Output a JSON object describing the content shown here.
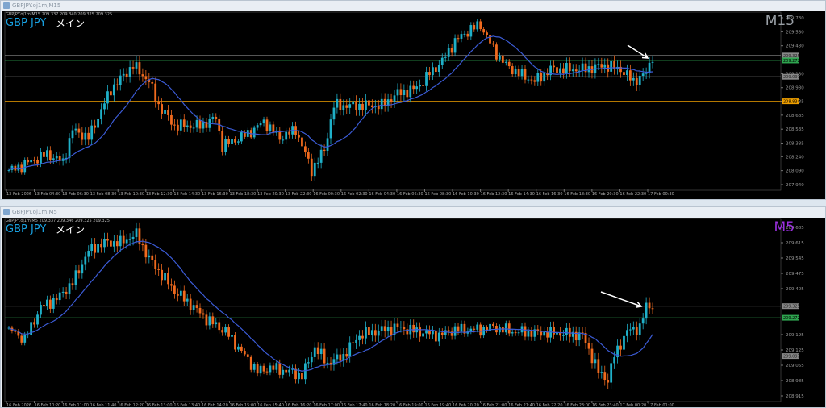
{
  "windows": [
    {
      "title": "GBPJPY.oj1m,M15",
      "header": "GBPJPY.oj1m,M15  209.337 209.340 209.325 209.325",
      "symbol": "GBP JPY",
      "mode": "メイン",
      "timeframe": "M15",
      "timeframe_color": "#9aa0a6"
    },
    {
      "title": "GBPJPY.oj1m,M5",
      "header": "GBPJPY.oj1m,M5  209.337 209.346 209.325 209.325",
      "symbol": "GBP JPY",
      "mode": "メイン",
      "timeframe": "M5",
      "timeframe_color": "#9b30e0"
    }
  ],
  "colors": {
    "bull": "#1fb0c8",
    "bear": "#f06a1e",
    "ma": "#3b5bd6",
    "green_line": "#2ea44f",
    "orange_line": "#f0a000",
    "gray_line": "#888888"
  },
  "chart_data": [
    {
      "type": "candlestick",
      "title": "GBPJPY M15",
      "ylim": [
        207.94,
        209.73
      ],
      "yticks": [
        "209.730",
        "209.580",
        "209.430",
        "209.130",
        "208.980",
        "208.835",
        "208.685",
        "208.535",
        "208.385",
        "208.240",
        "208.090",
        "207.940"
      ],
      "xticks": [
        "13 Feb 2026",
        "13 Feb 04:30",
        "13 Feb 06:30",
        "13 Feb 08:30",
        "13 Feb 10:30",
        "13 Feb 12:30",
        "13 Feb 14:30",
        "13 Feb 16:30",
        "13 Feb 18:30",
        "13 Feb 20:30",
        "13 Feb 22:30",
        "16 Feb 00:30",
        "16 Feb 02:30",
        "16 Feb 04:30",
        "16 Feb 06:30",
        "16 Feb 08:30",
        "16 Feb 10:30",
        "16 Feb 12:30",
        "16 Feb 14:30",
        "16 Feb 16:30",
        "16 Feb 18:30",
        "16 Feb 20:30",
        "16 Feb 22:30",
        "17 Feb 00:30"
      ],
      "bars": 203,
      "close_path": [
        [
          1,
          208.096
        ],
        [
          12,
          208.269
        ],
        [
          17,
          208.182
        ],
        [
          20,
          208.528
        ],
        [
          25,
          208.442
        ],
        [
          32,
          208.961
        ],
        [
          39,
          209.22
        ],
        [
          44,
          209.047
        ],
        [
          47,
          208.788
        ],
        [
          52,
          208.571
        ],
        [
          60,
          208.571
        ],
        [
          65,
          208.658
        ],
        [
          67,
          208.355
        ],
        [
          75,
          208.485
        ],
        [
          80,
          208.615
        ],
        [
          85,
          208.442
        ],
        [
          90,
          208.528
        ],
        [
          95,
          208.096
        ],
        [
          99,
          208.312
        ],
        [
          102,
          208.788
        ],
        [
          110,
          208.788
        ],
        [
          117,
          208.788
        ],
        [
          122,
          208.918
        ],
        [
          127,
          208.961
        ],
        [
          130,
          209.047
        ],
        [
          132,
          209.134
        ],
        [
          136,
          209.264
        ],
        [
          140,
          209.48
        ],
        [
          145,
          209.61
        ],
        [
          148,
          209.653
        ],
        [
          152,
          209.393
        ],
        [
          156,
          209.22
        ],
        [
          160,
          209.134
        ],
        [
          165,
          209.047
        ],
        [
          170,
          209.177
        ],
        [
          180,
          209.177
        ],
        [
          187,
          209.22
        ],
        [
          192,
          209.177
        ],
        [
          196,
          209.047
        ],
        [
          200,
          209.134
        ],
        [
          202,
          209.324
        ]
      ],
      "levels": [
        {
          "label": "209.325",
          "price": 209.325,
          "kind": "gray"
        },
        {
          "label": "209.272",
          "price": 209.272,
          "kind": "green"
        },
        {
          "label": "209.097",
          "price": 209.097,
          "kind": "gray"
        },
        {
          "label": "208.834",
          "price": 208.834,
          "kind": "orange"
        }
      ]
    },
    {
      "type": "candlestick",
      "title": "GBPJPY M5",
      "ylim": [
        208.915,
        209.685
      ],
      "yticks": [
        "209.685",
        "209.615",
        "209.545",
        "209.475",
        "209.405",
        "209.195",
        "209.125",
        "209.055",
        "208.985",
        "208.915"
      ],
      "xticks": [
        "16 Feb 2026",
        "16 Feb 10:20",
        "16 Feb 11:00",
        "16 Feb 11:40",
        "16 Feb 12:20",
        "16 Feb 13:00",
        "16 Feb 13:40",
        "16 Feb 14:20",
        "16 Feb 15:00",
        "16 Feb 15:40",
        "16 Feb 16:20",
        "16 Feb 17:00",
        "16 Feb 17:40",
        "16 Feb 18:20",
        "16 Feb 19:00",
        "16 Feb 19:40",
        "16 Feb 20:20",
        "16 Feb 21:00",
        "16 Feb 21:40",
        "16 Feb 22:20",
        "16 Feb 23:00",
        "16 Feb 23:40",
        "17 Feb 00:20",
        "17 Feb 01:00"
      ],
      "bars": 203,
      "close_path": [
        [
          1,
          209.21
        ],
        [
          5,
          209.173
        ],
        [
          10,
          209.321
        ],
        [
          15,
          209.358
        ],
        [
          20,
          209.432
        ],
        [
          25,
          209.579
        ],
        [
          30,
          209.616
        ],
        [
          35,
          209.616
        ],
        [
          40,
          209.653
        ],
        [
          44,
          209.542
        ],
        [
          48,
          209.468
        ],
        [
          52,
          209.395
        ],
        [
          58,
          209.321
        ],
        [
          62,
          209.266
        ],
        [
          68,
          209.21
        ],
        [
          72,
          209.136
        ],
        [
          78,
          209.026
        ],
        [
          82,
          209.044
        ],
        [
          88,
          209.026
        ],
        [
          92,
          209.007
        ],
        [
          96,
          209.136
        ],
        [
          100,
          209.063
        ],
        [
          105,
          209.099
        ],
        [
          110,
          209.192
        ],
        [
          115,
          209.21
        ],
        [
          122,
          209.229
        ],
        [
          128,
          209.21
        ],
        [
          135,
          209.192
        ],
        [
          140,
          209.218
        ],
        [
          148,
          209.218
        ],
        [
          152,
          209.229
        ],
        [
          158,
          209.21
        ],
        [
          165,
          209.203
        ],
        [
          172,
          209.203
        ],
        [
          180,
          209.192
        ],
        [
          185,
          209.026
        ],
        [
          188,
          208.989
        ],
        [
          190,
          209.099
        ],
        [
          194,
          209.21
        ],
        [
          198,
          209.229
        ],
        [
          200,
          209.321
        ],
        [
          202,
          209.33
        ]
      ],
      "levels": [
        {
          "label": "209.325",
          "price": 209.325,
          "kind": "gray"
        },
        {
          "label": "209.272",
          "price": 209.272,
          "kind": "green"
        },
        {
          "label": "209.097",
          "price": 209.097,
          "kind": "gray"
        }
      ]
    }
  ]
}
